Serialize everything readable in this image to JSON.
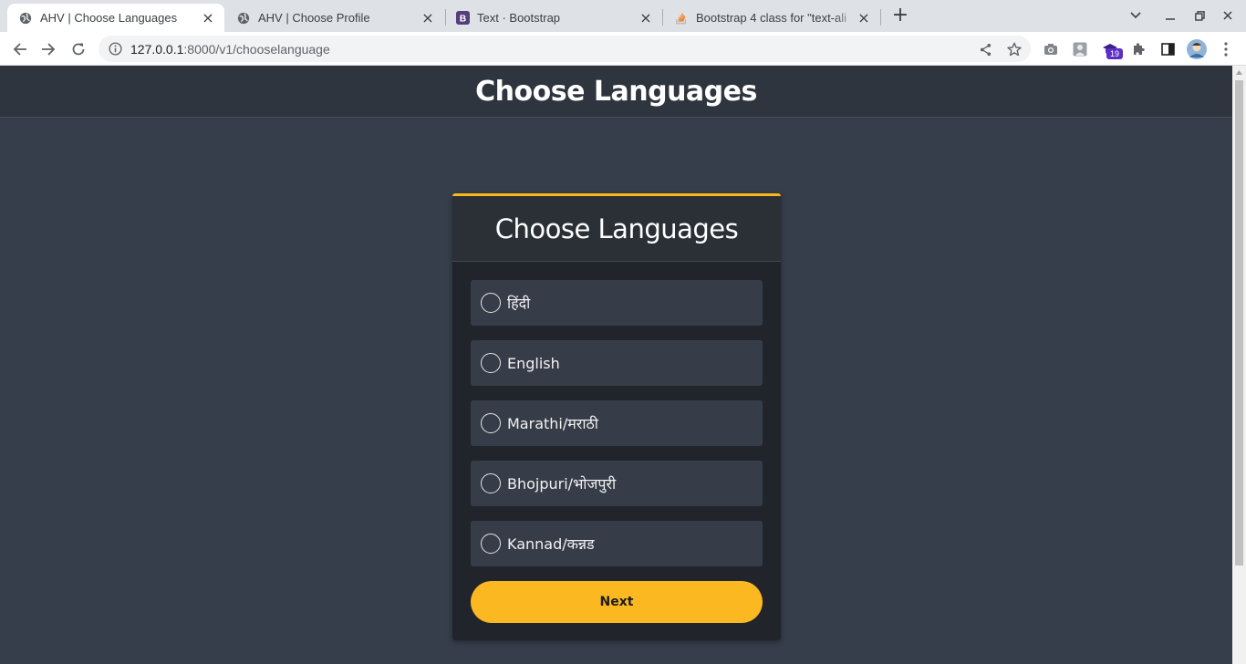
{
  "browser": {
    "tabs": [
      {
        "title": "AHV | Choose Languages",
        "active": true,
        "favicon": "globe-icon"
      },
      {
        "title": "AHV | Choose Profile",
        "active": false,
        "favicon": "globe-icon"
      },
      {
        "title": "Text · Bootstrap",
        "active": false,
        "favicon": "bootstrap-icon"
      },
      {
        "title": "Bootstrap 4 class for \"text-ali",
        "active": false,
        "favicon": "stackoverflow-icon"
      }
    ],
    "url_host": "127.0.0.1",
    "url_path": ":8000/v1/chooselanguage",
    "extension_badge": "19",
    "colors": {
      "accent_badge": "#5b2fc7"
    }
  },
  "page": {
    "header_title": "Choose Languages",
    "card": {
      "title": "Choose Languages",
      "options": [
        {
          "label": "हिंदी"
        },
        {
          "label": "English"
        },
        {
          "label": "Marathi/मराठी"
        },
        {
          "label": "Bhojpuri/भोजपुरी"
        },
        {
          "label": "Kannad/कन्नड"
        }
      ],
      "next_label": "Next"
    },
    "colors": {
      "accent": "#fbb820",
      "background": "#363e4b",
      "card": "#21252b"
    }
  }
}
